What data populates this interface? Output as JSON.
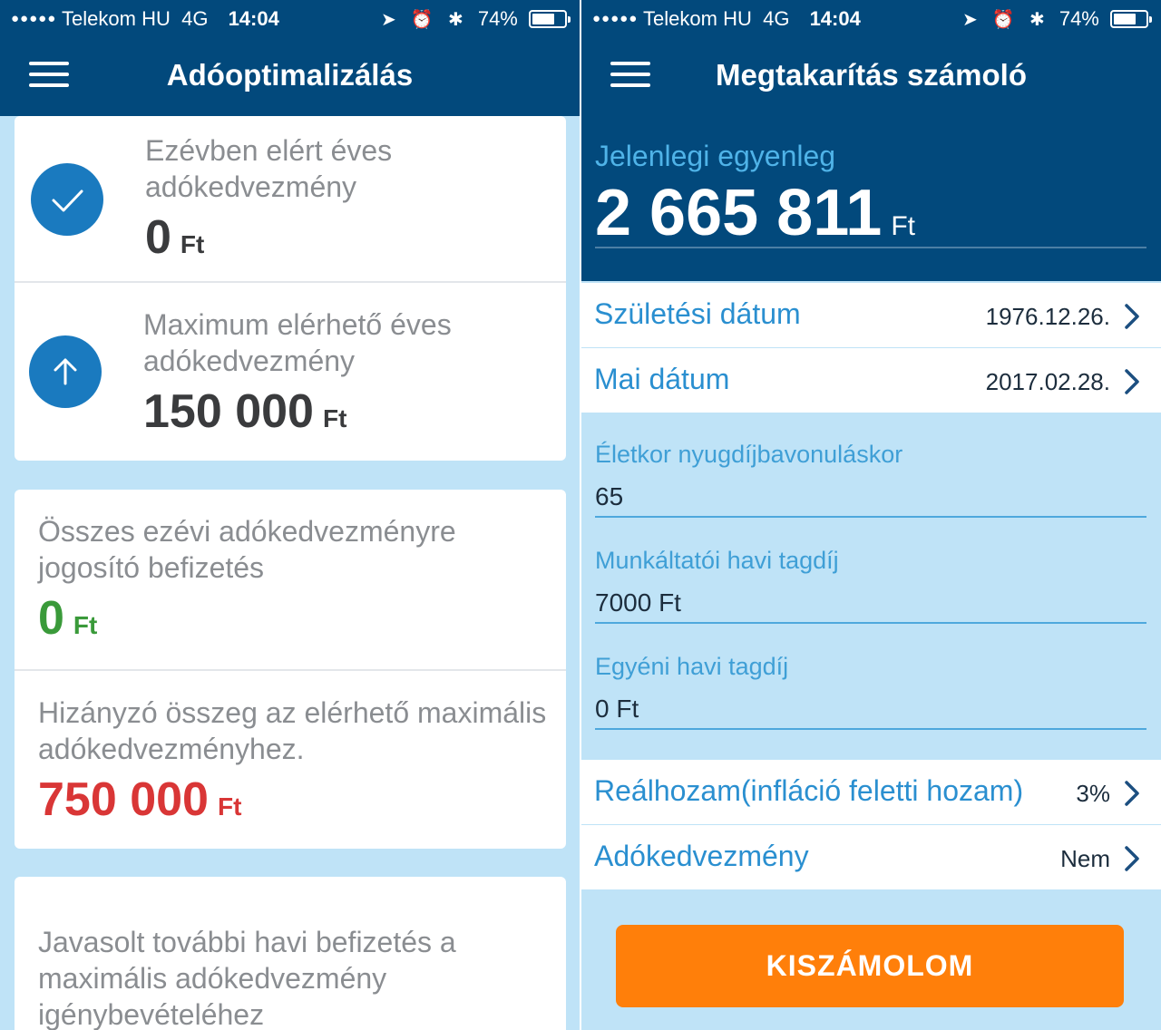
{
  "status_bar": {
    "carrier": "Telekom HU",
    "network": "4G",
    "time": "14:04",
    "battery": "74%",
    "battery_level": 0.74
  },
  "left_screen": {
    "title": "Adóoptimalizálás",
    "card1": {
      "achieved": {
        "label": "Ezévben elért éves adókedvezmény",
        "value": "0",
        "unit": "Ft"
      },
      "maximum": {
        "label": "Maximum elérhető éves adókedvezmény",
        "value": "150 000",
        "unit": "Ft"
      }
    },
    "card2": {
      "total_payment": {
        "label": "Összes ezévi adókedvezményre jogosító befizetés",
        "value": "0",
        "unit": "Ft"
      },
      "missing": {
        "label": "Hizányzó összeg az elérhető maximális adókedvezményhez.",
        "value": "750 000",
        "unit": "Ft"
      }
    },
    "card3": {
      "label": "Javasolt további havi befizetés a maximális adókedvezmény igénybevételéhez"
    }
  },
  "right_screen": {
    "title": "Megtakarítás számoló",
    "balance": {
      "label": "Jelenlegi egyenleg",
      "value": "2 665 811",
      "unit": "Ft"
    },
    "rows": {
      "birth_date": {
        "label": "Születési dátum",
        "value": "1976.12.26."
      },
      "today": {
        "label": "Mai dátum",
        "value": "2017.02.28."
      },
      "real_yield": {
        "label": "Reálhozam(infláció feletti hozam)",
        "value": "3%"
      },
      "tax_benefit": {
        "label": "Adókedvezmény",
        "value": "Nem"
      }
    },
    "fields": {
      "retirement_age": {
        "label": "Életkor nyugdíjbavonuláskor",
        "value": "65"
      },
      "employer_fee": {
        "label": "Munkáltatói havi tagdíj",
        "value": "7000 Ft"
      },
      "personal_fee": {
        "label": "Egyéni havi tagdíj",
        "value": "0 Ft"
      }
    },
    "button_label": "KISZÁMOLOM"
  },
  "colors": {
    "navy": "#02497c",
    "light_blue_bg": "#bfe3f7",
    "accent_blue": "#1a7abf",
    "green": "#3a9a3a",
    "red": "#d93636",
    "orange": "#ff7f0a"
  }
}
